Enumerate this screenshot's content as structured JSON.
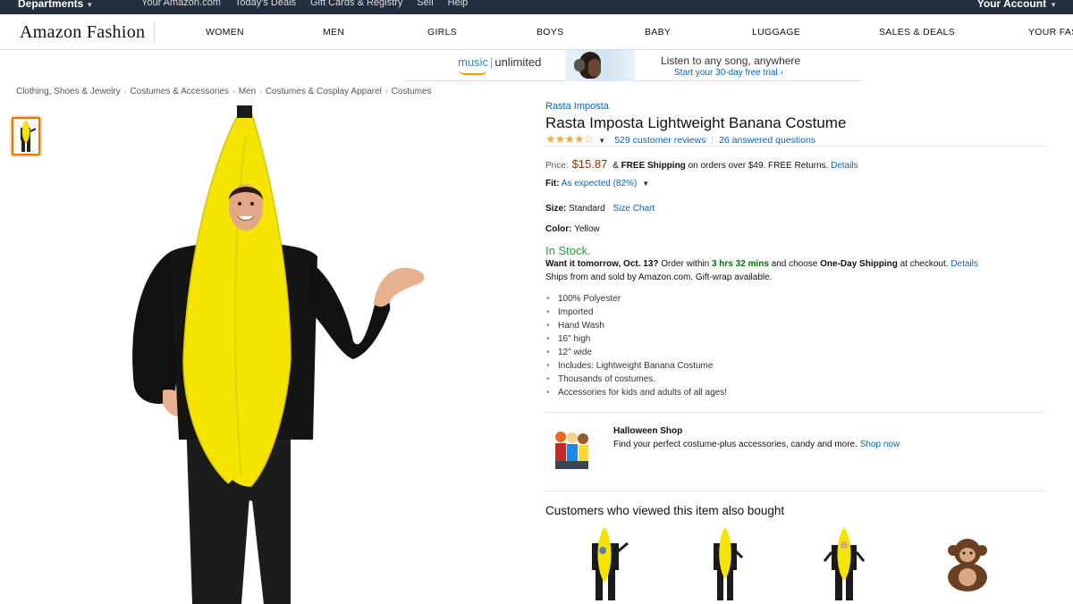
{
  "topbar": {
    "departments": "Departments",
    "links": [
      "Your Amazon.com",
      "Today's Deals",
      "Gift Cards & Registry",
      "Sell",
      "Help"
    ],
    "account": "Your Account"
  },
  "nav": {
    "logo": "Amazon Fashion",
    "items": [
      "WOMEN",
      "MEN",
      "GIRLS",
      "BOYS",
      "BABY",
      "LUGGAGE",
      "SALES & DEALS",
      "YOUR FAS"
    ]
  },
  "banner": {
    "brand_music": "music",
    "brand_unlimited": "unlimited",
    "tagline": "Listen to any song, anywhere",
    "trial": "Start your 30-day free trial ›"
  },
  "breadcrumb": [
    "Clothing, Shoes & Jewelry",
    "Costumes & Accessories",
    "Men",
    "Costumes & Cosplay Apparel",
    "Costumes"
  ],
  "product": {
    "brand": "Rasta Imposta",
    "title": "Rasta Imposta Lightweight Banana Costume",
    "stars": "★★★★☆",
    "reviews": "529 customer reviews",
    "questions": "26 answered questions",
    "price_label": "Price:",
    "price": "$15.87",
    "free_shipping_pre": "&",
    "free_shipping": "FREE Shipping",
    "free_shipping_post": "on orders over $49. FREE Returns.",
    "details": "Details",
    "fit_label": "Fit:",
    "fit_value": "As expected (82%)",
    "size_label": "Size:",
    "size_value": "Standard",
    "size_chart": "Size Chart",
    "color_label": "Color:",
    "color_value": "Yellow",
    "stock": "In Stock.",
    "delivery_want": "Want it tomorrow, Oct. 13?",
    "delivery_order": "Order within",
    "delivery_hrs": "3 hrs 32 mins",
    "delivery_choose": "and choose",
    "delivery_oneday": "One-Day Shipping",
    "delivery_checkout": "at checkout.",
    "delivery_details": "Details",
    "ships": "Ships from and sold by Amazon.com. Gift-wrap available.",
    "bullets": [
      "100% Polyester",
      "Imported",
      "Hand Wash",
      "16\" high",
      "12\" wide",
      "Includes: Lightweight Banana Costume",
      "Thousands of costumes.",
      "Accessories for kids and adults of all ages!"
    ]
  },
  "halloween": {
    "title": "Halloween Shop",
    "text": "Find your perfect costume-plus accessories, candy and more.",
    "link": "Shop now"
  },
  "also_bought": {
    "heading": "Customers who viewed this item also bought",
    "items": [
      "banana-costume-kid",
      "banana-costume-adult",
      "banana-costume-child",
      "monkey-costume-baby"
    ]
  },
  "colors": {
    "topbar_bg": "#232f3e",
    "link": "#0066c0",
    "price": "#b12704",
    "in_stock": "#2b9a3f",
    "star": "#f3a847",
    "banana": "#f5e400"
  }
}
